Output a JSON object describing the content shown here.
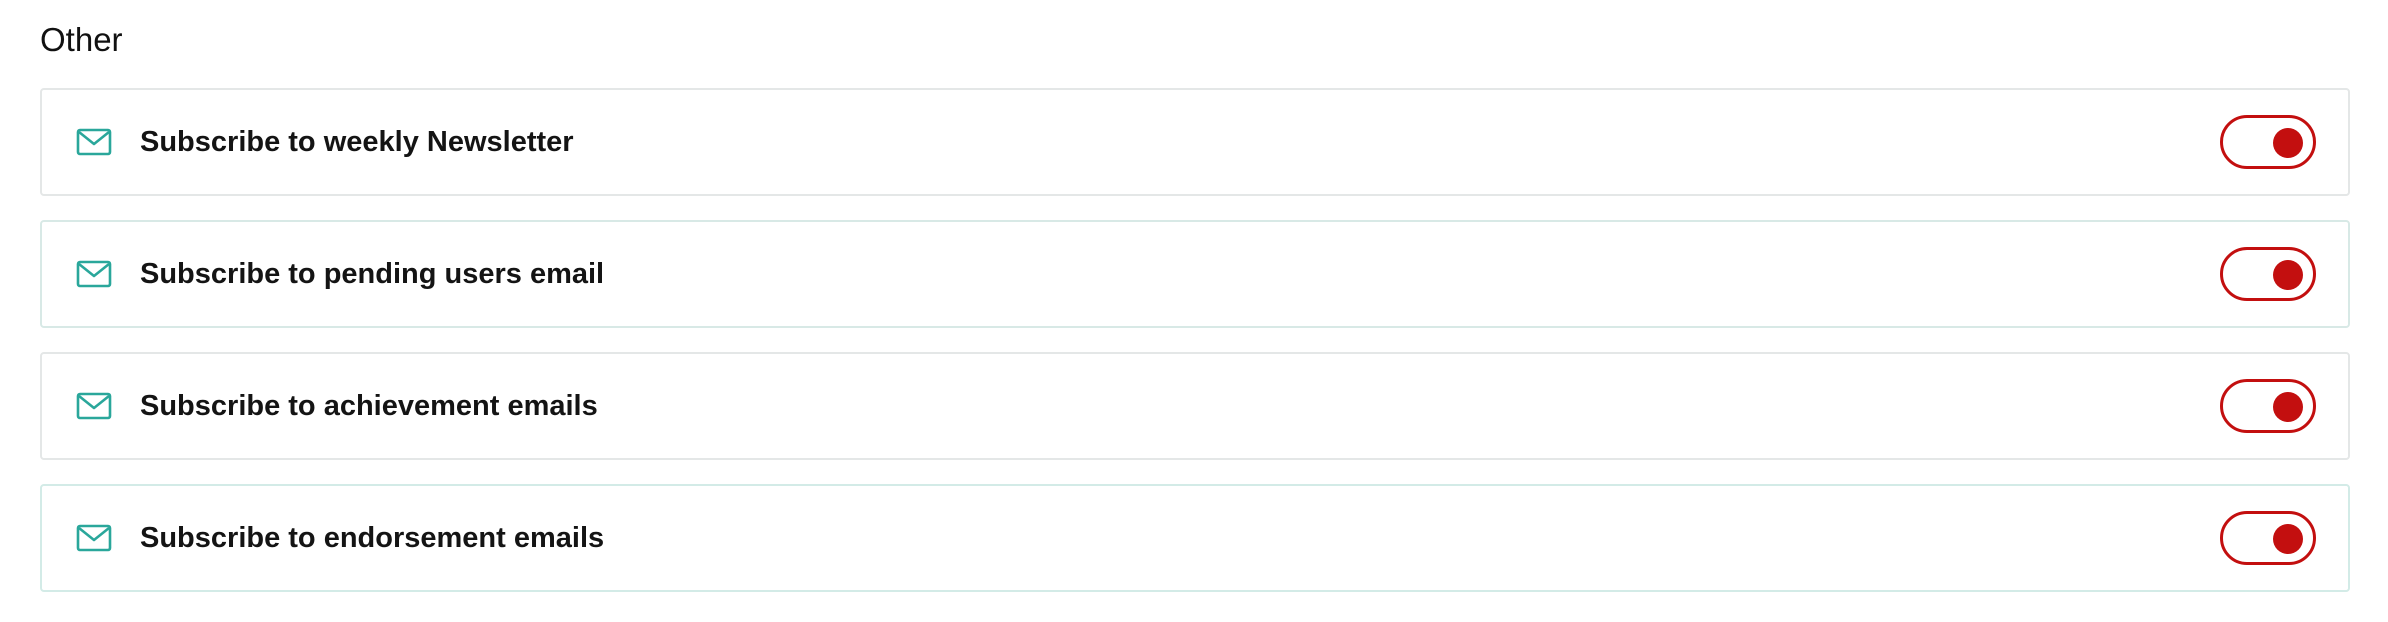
{
  "section": {
    "title": "Other"
  },
  "colors": {
    "accent_icon": "#2aa79b",
    "toggle_on": "#c30f0f"
  },
  "rows": [
    {
      "icon": "mail-icon",
      "label": "Subscribe to weekly Newsletter",
      "enabled": true
    },
    {
      "icon": "mail-icon",
      "label": "Subscribe to pending users email",
      "enabled": true
    },
    {
      "icon": "mail-icon",
      "label": "Subscribe to achievement emails",
      "enabled": true
    },
    {
      "icon": "mail-icon",
      "label": "Subscribe to endorsement emails",
      "enabled": true
    }
  ]
}
